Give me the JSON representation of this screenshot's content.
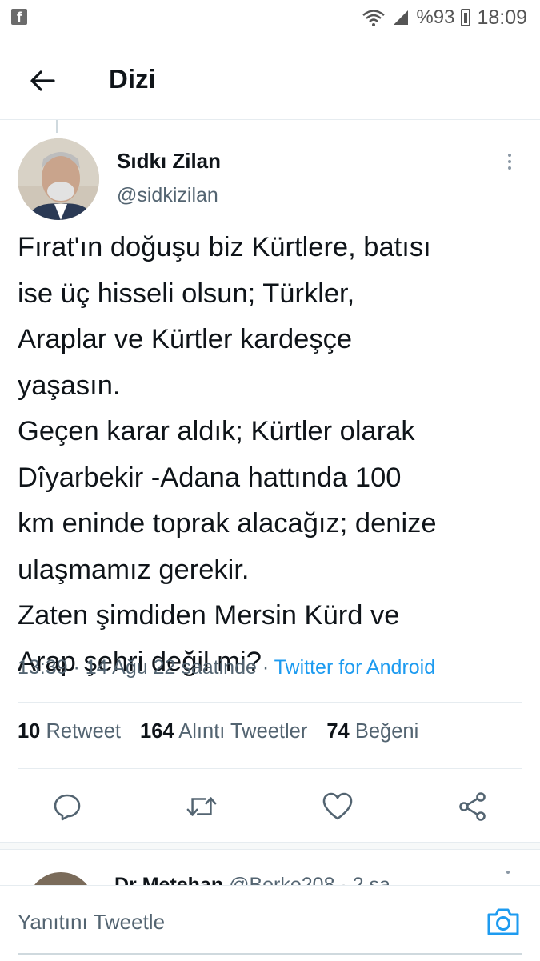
{
  "status_bar": {
    "battery": "%93",
    "time": "18:09"
  },
  "header": {
    "title": "Dizi"
  },
  "tweet": {
    "author_name": "Sıdkı Zilan",
    "author_handle": "@sidkizilan",
    "text_lines": [
      "Fırat'ın doğuşu biz Kürtlere, batısı",
      "ise üç hisseli olsun; Türkler,",
      "Araplar ve Kürtler kardeşçe",
      "yaşasın.",
      "Geçen karar aldık; Kürtler olarak",
      "Dîyarbekir -Adana hattında 100",
      "km eninde toprak alacağız; denize",
      "ulaşmamız gerekir.",
      "Zaten şimdiden Mersin Kürd ve",
      "Arap şehri değil mi?"
    ],
    "time": "13:39",
    "date": "14 Ağu 22 saatinde",
    "separator": "·",
    "source": "Twitter for Android"
  },
  "stats": {
    "retweets_count": "10",
    "retweets_label": "Retweet",
    "quotes_count": "164",
    "quotes_label": "Alıntı Tweetler",
    "likes_count": "74",
    "likes_label": "Beğeni"
  },
  "actions": [
    "reply-icon",
    "retweet-icon",
    "heart-icon",
    "share-icon"
  ],
  "next_reply": {
    "name": "Dr Metehan",
    "handle": "@Berke208 · 2 sa"
  },
  "composer": {
    "placeholder": "Yanıtını Tweetle"
  },
  "colors": {
    "accent": "#1d9bf0",
    "secondary_text": "#536471"
  }
}
